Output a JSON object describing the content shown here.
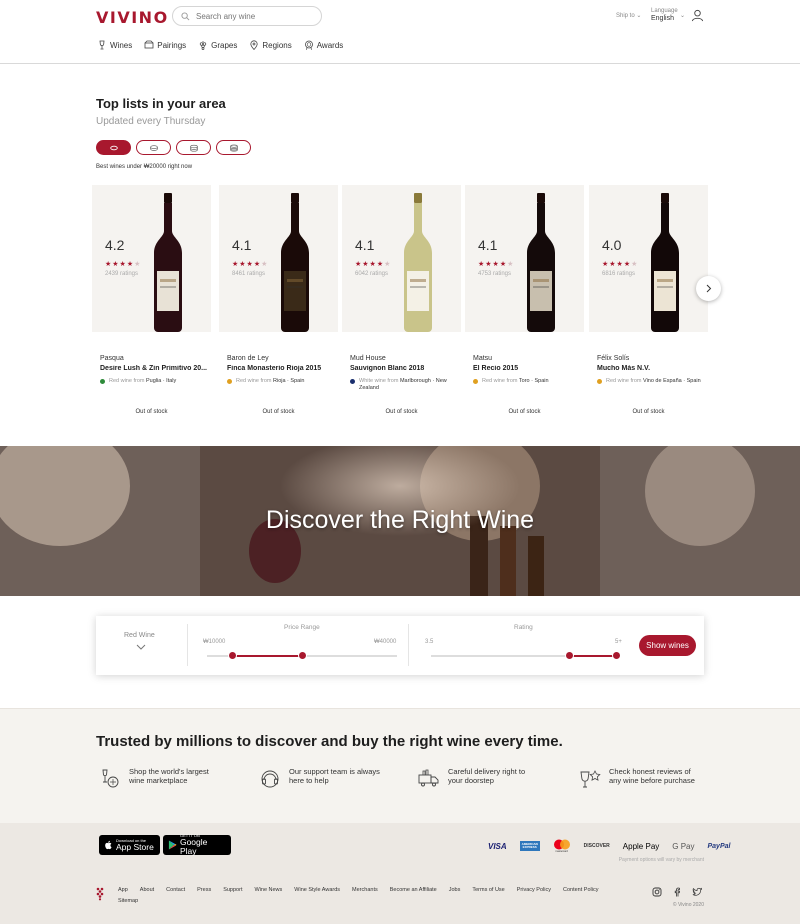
{
  "header": {
    "logo": "VIVINO",
    "search_placeholder": "Search any wine",
    "ship_to": "Ship to",
    "language_label": "Language",
    "language_value": "English"
  },
  "nav": [
    {
      "label": "Wines",
      "icon": "wine-glass-icon"
    },
    {
      "label": "Pairings",
      "icon": "pairings-icon"
    },
    {
      "label": "Grapes",
      "icon": "grapes-icon"
    },
    {
      "label": "Regions",
      "icon": "location-pin-icon"
    },
    {
      "label": "Awards",
      "icon": "award-icon"
    }
  ],
  "toplists": {
    "title": "Top lists in your area",
    "subtitle": "Updated every Thursday",
    "caption": "Best wines under ₩20000 right now",
    "pills": [
      {
        "icon": "coin-icon",
        "active": true
      },
      {
        "icon": "coins-2-icon",
        "active": false
      },
      {
        "icon": "coins-3-icon",
        "active": false
      },
      {
        "icon": "coins-4-icon",
        "active": false
      }
    ],
    "cards": [
      {
        "rating": "4.2",
        "stars": 4,
        "ratings_count": "2439 ratings",
        "winery": "Pasqua",
        "name": "Desire Lush & Zin Primitivo 20...",
        "type": "Red wine from",
        "region": "Puglia · Italy",
        "flag": "#2e8b3a",
        "status": "Out of stock",
        "bottle_color": "#2a0d12",
        "label_color": "#e8e2d6"
      },
      {
        "rating": "4.1",
        "stars": 4,
        "ratings_count": "8461 ratings",
        "winery": "Baron de Ley",
        "name": "Finca Monasterio Rioja 2015",
        "type": "Red wine from",
        "region": "Rioja · Spain",
        "flag": "#e0a020",
        "status": "Out of stock",
        "bottle_color": "#1a0a08",
        "label_color": "#3a2a18"
      },
      {
        "rating": "4.1",
        "stars": 4,
        "ratings_count": "6042 ratings",
        "winery": "Mud House",
        "name": "Sauvignon Blanc 2018",
        "type": "White wine from",
        "region": "Marlborough · New Zealand",
        "flag": "#1a2f6e",
        "status": "Out of stock",
        "bottle_color": "#c9c48a",
        "label_color": "#f4f1e6"
      },
      {
        "rating": "4.1",
        "stars": 4,
        "ratings_count": "4753 ratings",
        "winery": "Matsu",
        "name": "El Recio 2015",
        "type": "Red wine from",
        "region": "Toro · Spain",
        "flag": "#e0a020",
        "status": "Out of stock",
        "bottle_color": "#140a0a",
        "label_color": "#c8bfae"
      },
      {
        "rating": "4.0",
        "stars": 4,
        "ratings_count": "6816 ratings",
        "winery": "Félix Solís",
        "name": "Mucho Más N.V.",
        "type": "Red wine from",
        "region": "Vino de España · Spain",
        "flag": "#e0a020",
        "status": "Out of stock",
        "bottle_color": "#120808",
        "label_color": "#ece4d4"
      }
    ]
  },
  "hero": {
    "title": "Discover the Right Wine"
  },
  "filter": {
    "wine_type": "Red Wine",
    "price_label": "Price Range",
    "price_min": "₩10000",
    "price_max": "₩40000",
    "price_range_fraction": [
      0.0,
      0.5
    ],
    "rating_label": "Rating",
    "rating_min": "3.5",
    "rating_max": "5+",
    "rating_range_fraction": [
      0.75,
      1.0
    ],
    "button": "Show wines"
  },
  "trust": {
    "title": "Trusted by millions to discover and buy the right wine every time.",
    "items": [
      {
        "text": "Shop the world's largest wine marketplace",
        "icon": "marketplace-icon"
      },
      {
        "text": "Our support team is always here to help",
        "icon": "support-icon"
      },
      {
        "text": "Careful delivery right to your doorstep",
        "icon": "delivery-truck-icon"
      },
      {
        "text": "Check honest reviews of any wine before purchase",
        "icon": "reviews-icon"
      }
    ]
  },
  "footer": {
    "app_store_small": "Download on the",
    "app_store": "App Store",
    "google_play_small": "GET IT ON",
    "google_play": "Google Play",
    "payments": [
      "VISA",
      "AMERICAN EXPRESS",
      "mastercard",
      "DISCOVER",
      "Apple Pay",
      "G Pay",
      "PayPal"
    ],
    "payment_note": "Payment options will vary by merchant",
    "links": [
      "App",
      "About",
      "Contact",
      "Press",
      "Support",
      "Wine News",
      "Wine Style Awards",
      "Merchants",
      "Become an Affiliate",
      "Jobs",
      "Terms of Use",
      "Privacy Policy",
      "Content Policy",
      "Sitemap"
    ],
    "copyright": "© Vivino 2020"
  }
}
